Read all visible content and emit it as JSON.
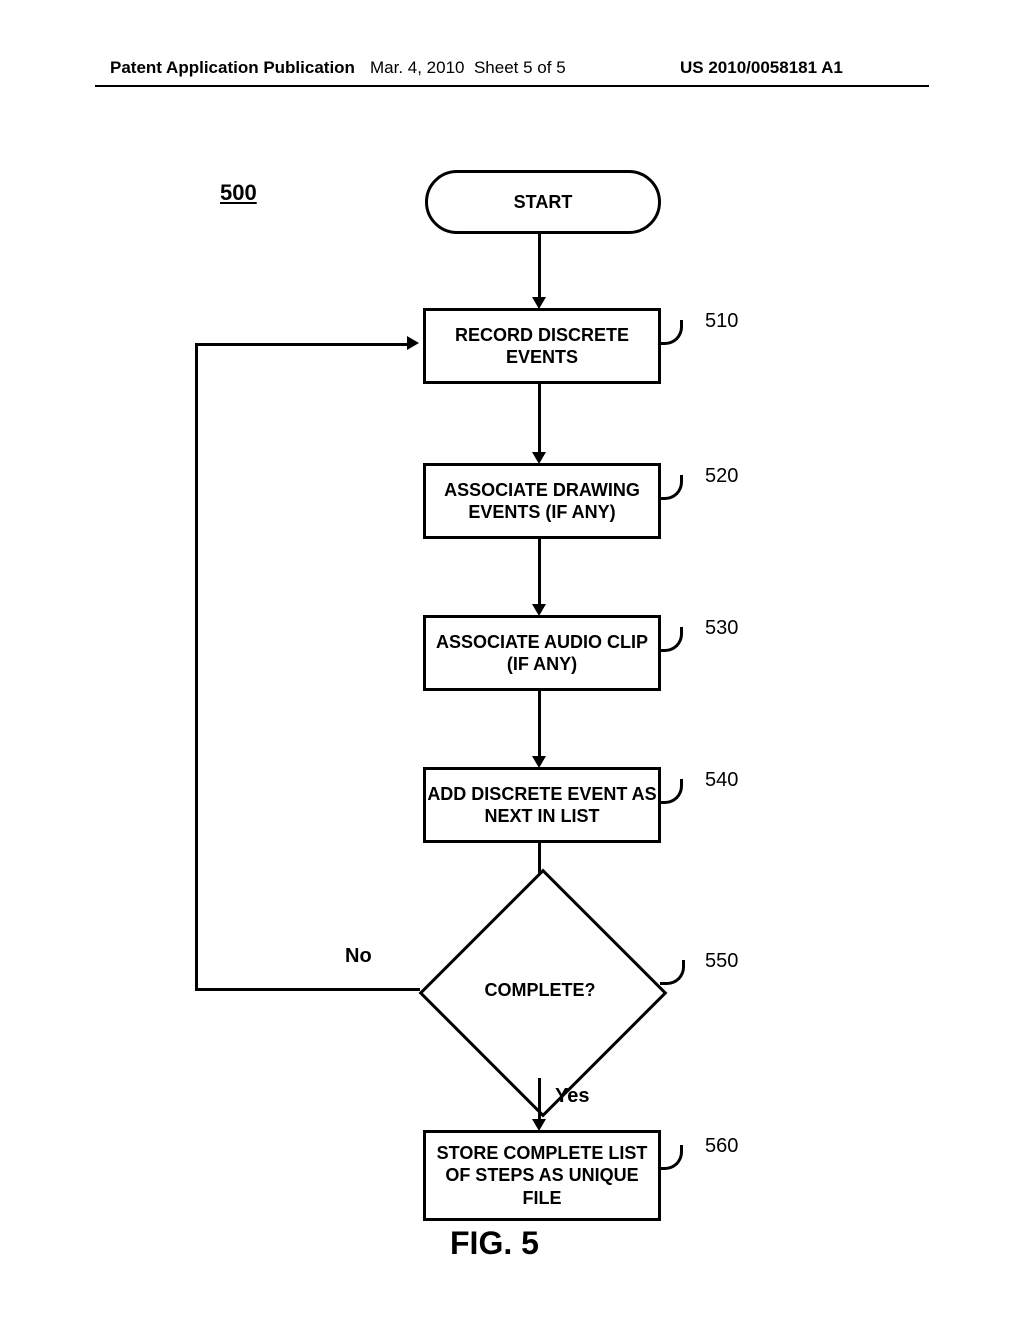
{
  "header": {
    "left": "Patent Application Publication",
    "date": "Mar. 4, 2010",
    "sheet": "Sheet 5 of 5",
    "pubno": "US 2010/0058181 A1"
  },
  "figure_ref": "500",
  "nodes": {
    "start": "START",
    "s510": "RECORD DISCRETE EVENTS",
    "s520": "ASSOCIATE DRAWING EVENTS (IF ANY)",
    "s530": "ASSOCIATE AUDIO CLIP (IF ANY)",
    "s540": "ADD DISCRETE EVENT AS NEXT IN LIST",
    "decision": "COMPLETE?",
    "s560": "STORE COMPLETE LIST OF STEPS AS UNIQUE FILE"
  },
  "labels": {
    "no": "No",
    "yes": "Yes"
  },
  "refs": {
    "r510": "510",
    "r520": "520",
    "r530": "530",
    "r540": "540",
    "r550": "550",
    "r560": "560"
  },
  "figure_caption": "FIG. 5"
}
